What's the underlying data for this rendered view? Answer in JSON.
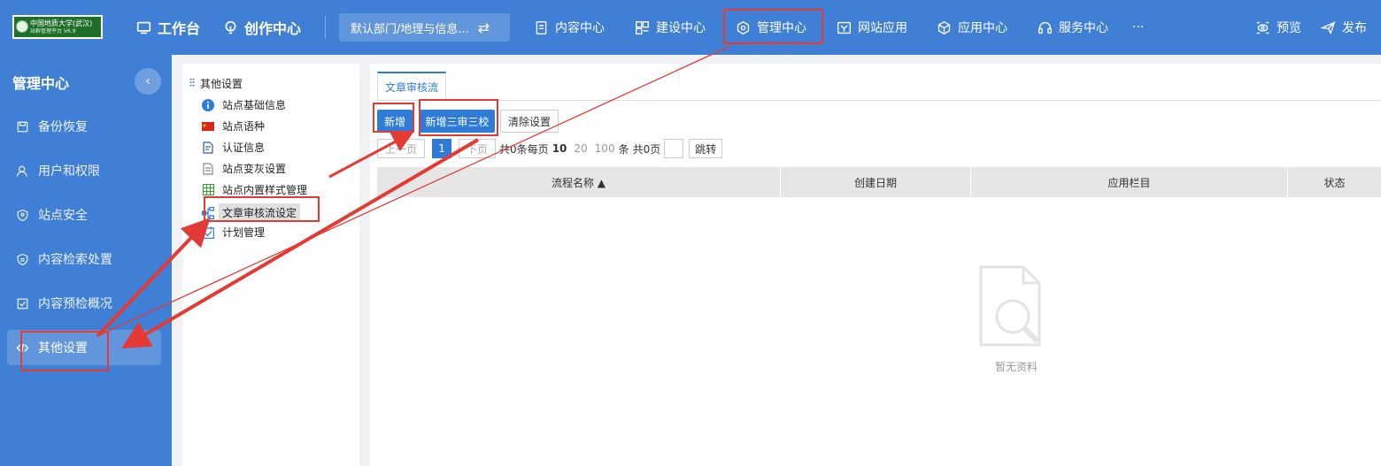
{
  "topbar": {
    "logo": {
      "line1": "中国地质大学(武汉)",
      "line2": "站群管理平台 V6.9"
    },
    "workbench": "工作台",
    "creation": "创作中心",
    "department": "默认部门/地理与信息...",
    "nav": [
      {
        "label": "内容中心",
        "icon": "document-icon"
      },
      {
        "label": "建设中心",
        "icon": "layout-icon"
      },
      {
        "label": "管理中心",
        "icon": "hexagon-icon"
      },
      {
        "label": "网站应用",
        "icon": "web-icon"
      },
      {
        "label": "应用中心",
        "icon": "cube-icon"
      },
      {
        "label": "服务中心",
        "icon": "headset-icon"
      }
    ],
    "more": "···",
    "preview": "预览",
    "publish": "发布"
  },
  "sidebar": {
    "title": "管理中心",
    "items": [
      {
        "label": "备份恢复",
        "icon": "save-icon"
      },
      {
        "label": "用户和权限",
        "icon": "user-icon"
      },
      {
        "label": "站点安全",
        "icon": "shield-icon"
      },
      {
        "label": "内容检索处置",
        "icon": "badge-icon"
      },
      {
        "label": "内容预检概况",
        "icon": "check-icon"
      },
      {
        "label": "其他设置",
        "icon": "code-icon",
        "active": true
      }
    ]
  },
  "tree": {
    "root": "其他设置",
    "items": [
      {
        "label": "站点基础信息",
        "icon": "info-icon"
      },
      {
        "label": "站点语种",
        "icon": "flag-icon"
      },
      {
        "label": "认证信息",
        "icon": "cert-icon"
      },
      {
        "label": "站点变灰设置",
        "icon": "file-icon"
      },
      {
        "label": "站点内置样式管理",
        "icon": "grid-icon"
      },
      {
        "label": "文章审核流设定",
        "icon": "flow-icon",
        "selected": true
      },
      {
        "label": "计划管理",
        "icon": "plan-icon"
      }
    ]
  },
  "main": {
    "tab": "文章审核流",
    "buttons": {
      "add": "新增",
      "add_three": "新增三审三校",
      "clear": "清除设置"
    },
    "pager": {
      "prev": "上一页",
      "current": "1",
      "next": "下页",
      "total": "共0条",
      "per_page": "每页",
      "sizes": [
        "10",
        "20",
        "100"
      ],
      "unit": "条",
      "pages": "共0页",
      "jump": "跳转"
    },
    "columns": [
      "流程名称 ▲",
      "创建日期",
      "应用栏目",
      "状态"
    ],
    "empty": "暂无资料"
  },
  "colors": {
    "brand": "#3f7fd6",
    "primary": "#2f7bd8",
    "annotation": "#e53935"
  }
}
